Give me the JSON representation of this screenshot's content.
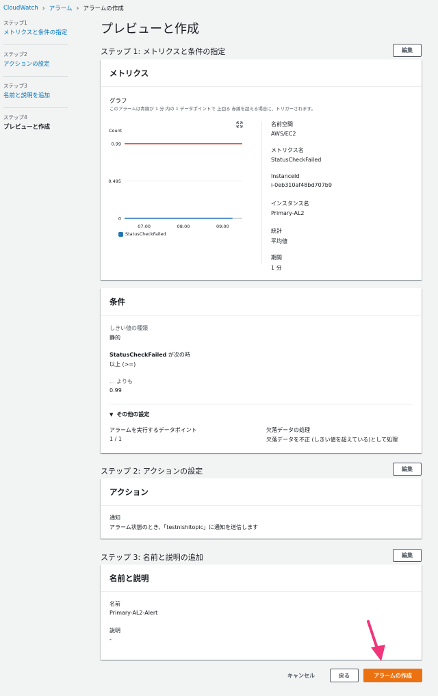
{
  "breadcrumb": {
    "root": "CloudWatch",
    "alarms": "アラーム",
    "current": "アラームの作成"
  },
  "steps": [
    {
      "num": "ステップ1",
      "label": "メトリクスと条件の指定"
    },
    {
      "num": "ステップ2",
      "label": "アクションの設定"
    },
    {
      "num": "ステップ3",
      "label": "名前と説明を追加"
    },
    {
      "num": "ステップ4",
      "label": "プレビューと作成"
    }
  ],
  "page_title": "プレビューと作成",
  "step1": {
    "heading": "ステップ 1: メトリクスと条件の指定",
    "edit": "編集",
    "card_title": "メトリクス",
    "graph_title": "グラフ",
    "graph_desc": "このアラームは青線が 1 分 内の 1 データポイントで 上回る 赤線を超える場合に、トリガーされます。",
    "meta": [
      {
        "label": "名前空間",
        "value": "AWS/EC2"
      },
      {
        "label": "メトリクス名",
        "value": "StatusCheckFailed"
      },
      {
        "label": "InstanceId",
        "value": "i-0eb310af48bd707b9"
      },
      {
        "label": "インスタンス名",
        "value": "Primary-AL2"
      },
      {
        "label": "統計",
        "value": "平均値"
      },
      {
        "label": "期間",
        "value": "1 分"
      }
    ]
  },
  "chart_data": {
    "type": "line",
    "ylabel": "Count",
    "yticks": [
      "0.99",
      "0.495",
      "0"
    ],
    "ylim": [
      0,
      0.99
    ],
    "xticks": [
      "07:00",
      "08:00",
      "09:00"
    ],
    "threshold": 0.99,
    "threshold_color": "#d13212",
    "series": [
      {
        "name": "StatusCheckFailed",
        "color": "#1f77b4",
        "x": [
          "06:30",
          "09:15"
        ],
        "y": [
          0,
          0
        ]
      }
    ]
  },
  "conditions": {
    "card_title": "条件",
    "threshold_type_label": "しきい値の種類",
    "threshold_type_value": "静的",
    "metric_name": "StatusCheckFailed",
    "when_label": " が次の時",
    "when_value": "以上 (>=)",
    "than_label": "... よりも",
    "than_value": "0.99",
    "other_settings": "その他の設定",
    "datapoints_label": "アラームを実行するデータポイント",
    "datapoints_value": "1 / 1",
    "missing_label": "欠落データの処理",
    "missing_value": "欠落データを不正 (しきい値を超えている)として処理"
  },
  "step2": {
    "heading": "ステップ 2: アクションの設定",
    "edit": "編集",
    "card_title": "アクション",
    "notify_label": "通知",
    "notify_value": "アラーム状態のとき、「testnishitopic」に通知を送信します"
  },
  "step3": {
    "heading": "ステップ 3: 名前と説明の追加",
    "edit": "編集",
    "card_title": "名前と説明",
    "name_label": "名前",
    "name_value": "Primary-AL2-Alert",
    "desc_label": "説明",
    "desc_value": "-"
  },
  "footer": {
    "cancel": "キャンセル",
    "back": "戻る",
    "create": "アラームの作成"
  }
}
